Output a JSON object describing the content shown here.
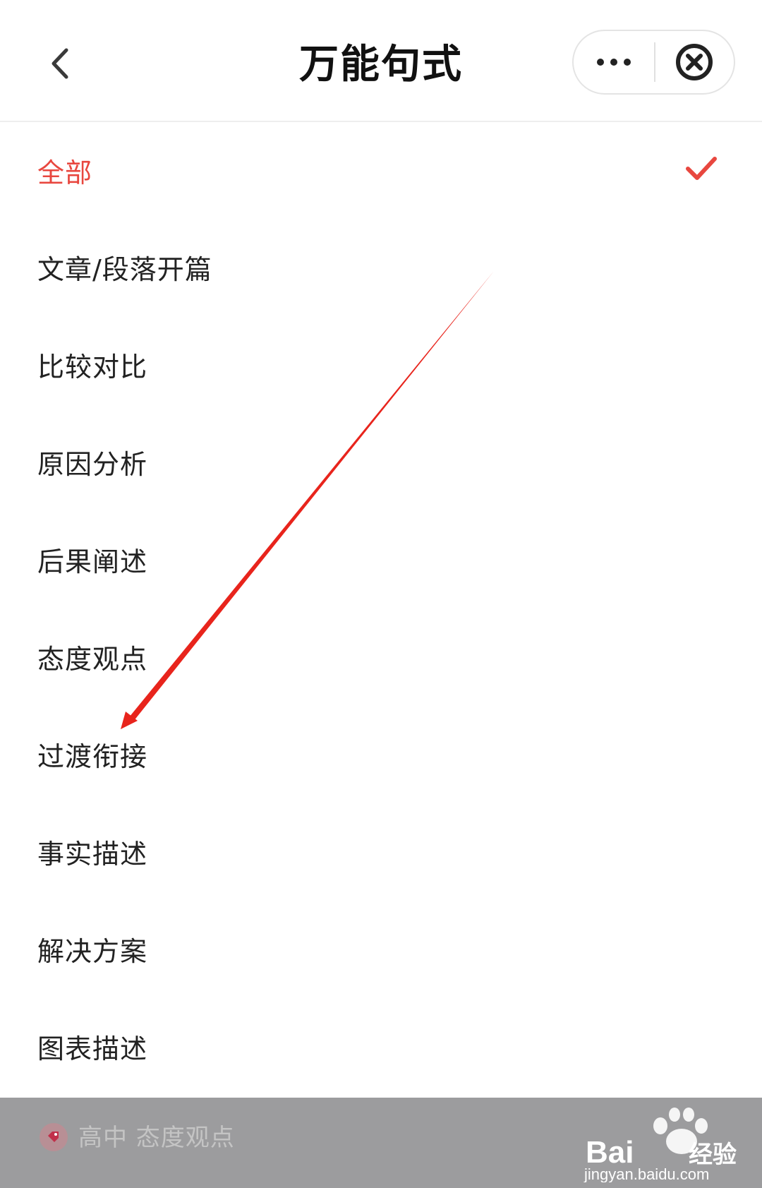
{
  "header": {
    "title": "万能句式"
  },
  "menu": {
    "items": [
      {
        "label": "全部",
        "active": true
      },
      {
        "label": "文章/段落开篇",
        "active": false
      },
      {
        "label": "比较对比",
        "active": false
      },
      {
        "label": "原因分析",
        "active": false
      },
      {
        "label": "后果阐述",
        "active": false
      },
      {
        "label": "态度观点",
        "active": false
      },
      {
        "label": "过渡衔接",
        "active": false
      },
      {
        "label": "事实描述",
        "active": false
      },
      {
        "label": "解决方案",
        "active": false
      },
      {
        "label": "图表描述",
        "active": false
      }
    ]
  },
  "bottom": {
    "label": "高中 态度观点"
  },
  "watermark": {
    "brand": "Bai",
    "brand_suffix": "经验",
    "url": "jingyan.baidu.com"
  },
  "icons": {
    "back": "chevron-left-icon",
    "more": "more-dots-icon",
    "close": "close-circle-icon",
    "check": "checkmark-icon",
    "tag": "tag-icon",
    "paw": "paw-icon"
  },
  "colors": {
    "accent": "#e8473f",
    "text": "#222222",
    "annotation_arrow": "#e8241c",
    "bottom_bar": "#9c9c9e"
  }
}
